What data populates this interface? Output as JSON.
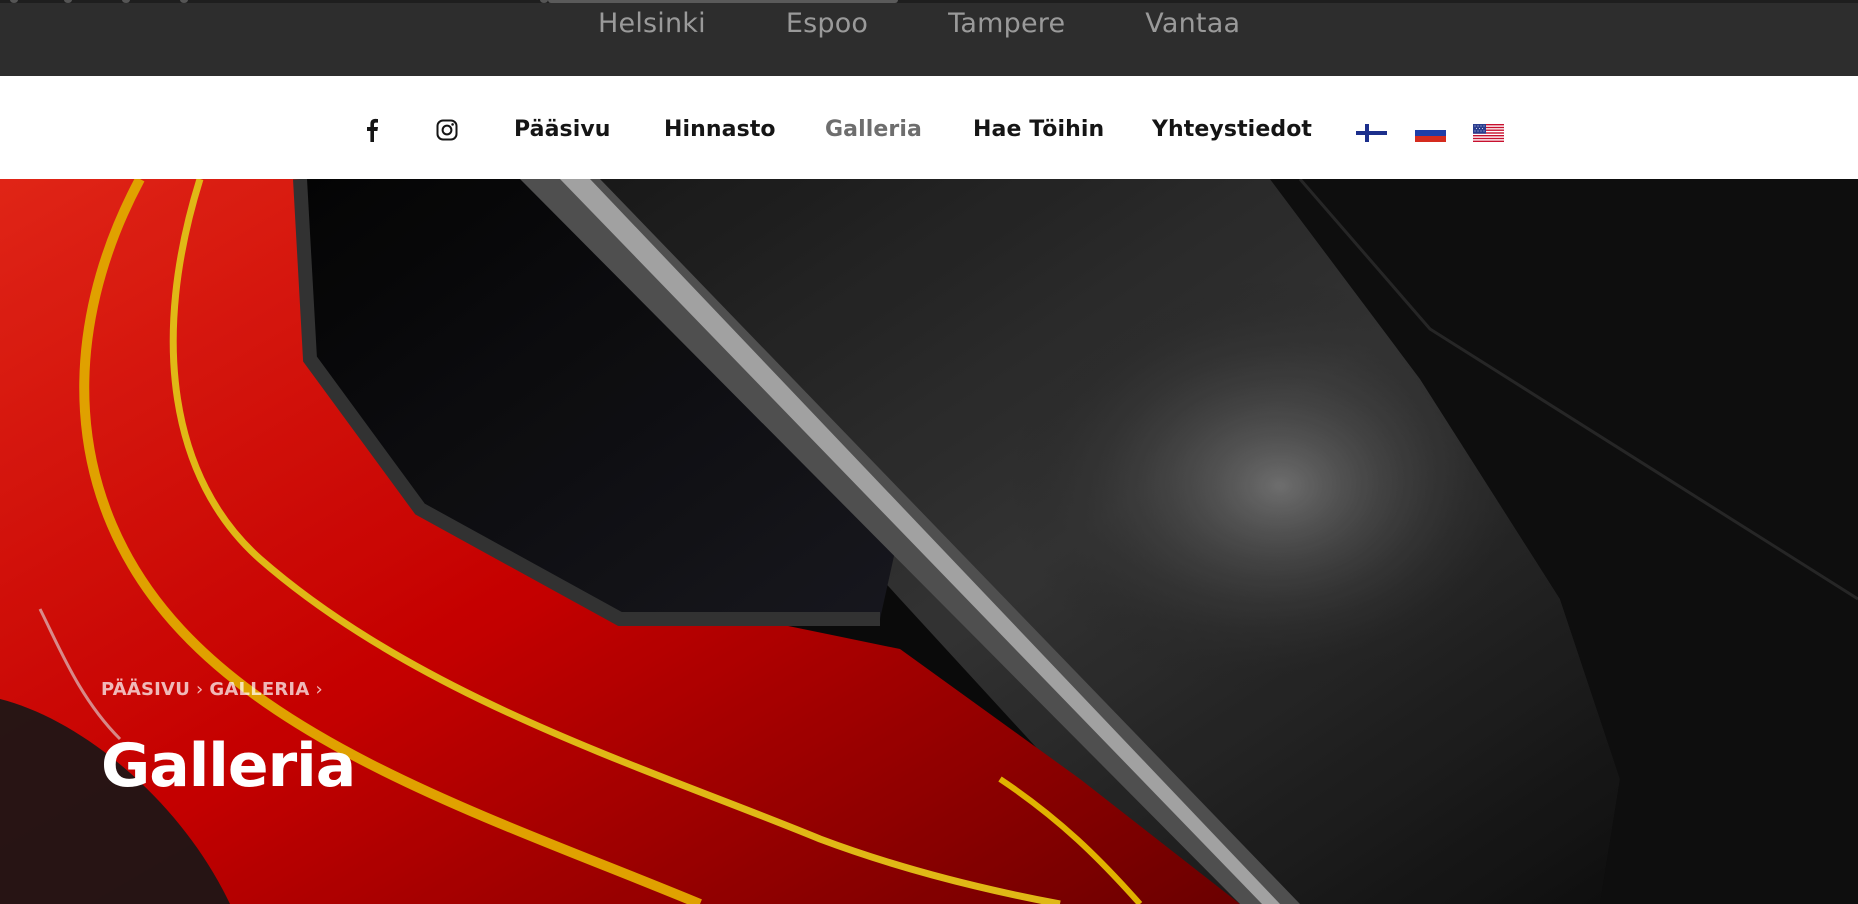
{
  "cities": [
    "Helsinki",
    "Espoo",
    "Tampere",
    "Vantaa"
  ],
  "social": {
    "facebook": "facebook-icon",
    "instagram": "instagram-icon"
  },
  "nav": {
    "items": [
      {
        "label": "Pääsivu",
        "active": false
      },
      {
        "label": "Hinnasto",
        "active": false
      },
      {
        "label": "Galleria",
        "active": true
      },
      {
        "label": "Hae Töihin",
        "active": false
      },
      {
        "label": "Yhteystiedot",
        "active": false
      }
    ],
    "languages": [
      "fi-flag-icon",
      "ru-flag-icon",
      "us-flag-icon"
    ]
  },
  "hero": {
    "breadcrumb": [
      "PÄÄSIVU",
      "GALLERIA"
    ],
    "title": "Galleria"
  },
  "colors": {
    "topbar": "#2d2d2d",
    "nav_bg": "#ffffff",
    "nav_text": "#151515",
    "nav_active": "#6e6e6e",
    "accent_red": "#ff1a1a"
  }
}
